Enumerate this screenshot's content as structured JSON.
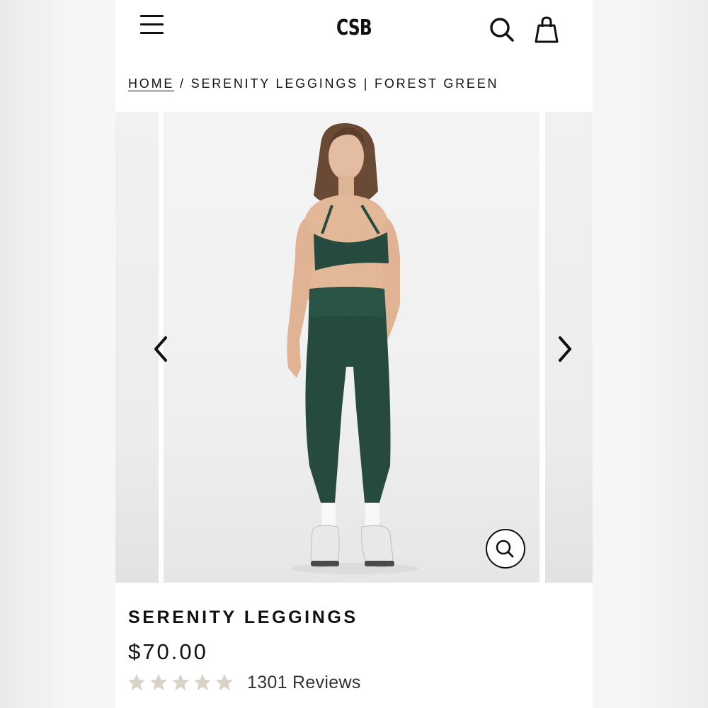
{
  "header": {
    "logo_text": "CSB",
    "icons": {
      "menu": "hamburger-menu-icon",
      "search": "search-icon",
      "cart": "shopping-bag-icon"
    }
  },
  "breadcrumb": {
    "home_label": "HOME",
    "separator": "/",
    "current_label": "SERENITY LEGGINGS | FOREST GREEN"
  },
  "gallery": {
    "icons": {
      "prev": "chevron-left-icon",
      "next": "chevron-right-icon",
      "zoom": "magnifier-icon"
    }
  },
  "product": {
    "title": "SERENITY LEGGINGS",
    "price": "$70.00",
    "rating_stars": 5,
    "reviews_label": "1301 Reviews"
  },
  "colors": {
    "text": "#111111",
    "star": "#d9d2c8",
    "garment": "#264a3e"
  }
}
